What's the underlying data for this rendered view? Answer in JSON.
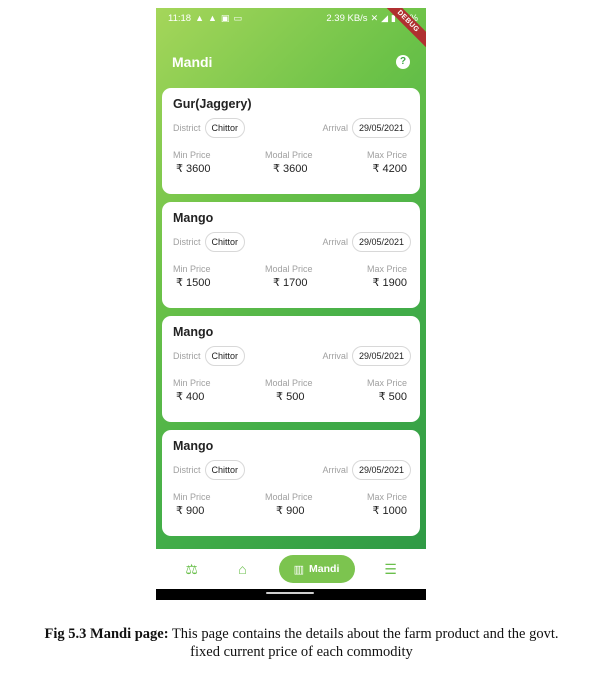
{
  "status_bar": {
    "time": "11:18",
    "network_speed": "2.39 KB/s",
    "battery": "61%",
    "debug_label": "DEBUG"
  },
  "app_bar": {
    "title": "Mandi",
    "help_icon": "question-circle-icon",
    "help_glyph": "?"
  },
  "card_labels": {
    "district": "District",
    "arrival": "Arrival",
    "min_price": "Min Price",
    "modal_price": "Modal Price",
    "max_price": "Max Price"
  },
  "commodities": [
    {
      "name": "Gur(Jaggery)",
      "district": "Chittor",
      "arrival": "29/05/2021",
      "min_price": "₹ 3600",
      "modal_price": "₹ 3600",
      "max_price": "₹ 4200"
    },
    {
      "name": "Mango",
      "district": "Chittor",
      "arrival": "29/05/2021",
      "min_price": "₹ 1500",
      "modal_price": "₹ 1700",
      "max_price": "₹ 1900"
    },
    {
      "name": "Mango",
      "district": "Chittor",
      "arrival": "29/05/2021",
      "min_price": "₹ 400",
      "modal_price": "₹ 500",
      "max_price": "₹ 500"
    },
    {
      "name": "Mango",
      "district": "Chittor",
      "arrival": "29/05/2021",
      "min_price": "₹ 900",
      "modal_price": "₹ 900",
      "max_price": "₹ 1000"
    }
  ],
  "bottom_nav": {
    "items": [
      {
        "icon": "scale-icon",
        "glyph": "⚖"
      },
      {
        "icon": "home-icon",
        "glyph": "⌂"
      },
      {
        "icon": "map-icon",
        "glyph": "▥",
        "label": "Mandi",
        "active": true
      },
      {
        "icon": "menu-icon",
        "glyph": "☰"
      }
    ]
  },
  "caption": {
    "bold": "Fig 5.3 Mandi page:",
    "text": " This page contains the details about the farm product and the govt.",
    "line2": "fixed current price of each commodity"
  },
  "colors": {
    "primary_green": "#43ae48",
    "accent_green": "#7cc44f"
  }
}
